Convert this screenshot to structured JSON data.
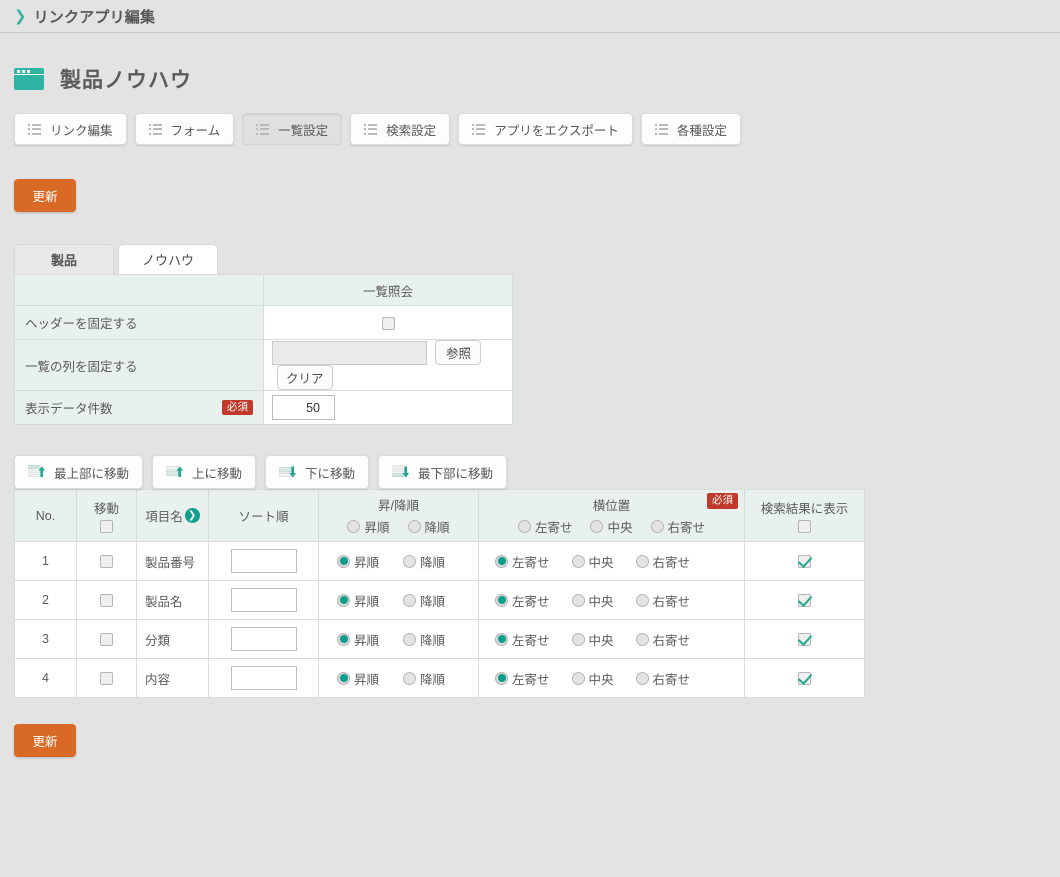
{
  "breadcrumb": {
    "icon": "chevron-right-icon",
    "label": "リンクアプリ編集"
  },
  "page": {
    "icon": "app-window-icon",
    "title": "製品ノウハウ"
  },
  "toolbar": {
    "items": [
      {
        "label": "リンク編集",
        "icon": "list-icon",
        "active": false
      },
      {
        "label": "フォーム",
        "icon": "list-icon",
        "active": false
      },
      {
        "label": "一覧設定",
        "icon": "list-icon",
        "active": true
      },
      {
        "label": "検索設定",
        "icon": "list-icon",
        "active": false
      },
      {
        "label": "アプリをエクスポート",
        "icon": "list-icon",
        "active": false
      },
      {
        "label": "各種設定",
        "icon": "list-icon",
        "active": false
      }
    ]
  },
  "update_top_label": "更新",
  "update_bottom_label": "更新",
  "tabs": [
    {
      "label": "製品",
      "selected": false
    },
    {
      "label": "ノウハウ",
      "selected": true
    }
  ],
  "settings": {
    "column_header": "一覧照会",
    "rows": [
      {
        "label": "ヘッダーを固定する",
        "type": "checkbox",
        "checked": false
      },
      {
        "label": "一覧の列を固定する",
        "type": "picker",
        "value": "",
        "browse_label": "参照",
        "clear_label": "クリア"
      },
      {
        "label": "表示データ件数",
        "required_badge": "必須",
        "type": "number",
        "value": "50"
      }
    ]
  },
  "move_buttons": [
    {
      "label": "最上部に移動",
      "icon": "move-top-icon"
    },
    {
      "label": "上に移動",
      "icon": "move-up-icon"
    },
    {
      "label": "下に移動",
      "icon": "move-down-icon"
    },
    {
      "label": "最下部に移動",
      "icon": "move-bottom-icon"
    }
  ],
  "field_table": {
    "headers": {
      "no": "No.",
      "move": "移動",
      "move_all_checked": false,
      "name": "項目名",
      "name_icon": "chevron-right-circle-icon",
      "sort": "ソート順",
      "order_title": "昇/降順",
      "order_asc": "昇順",
      "order_desc": "降順",
      "order_asc_checked": false,
      "order_desc_checked": false,
      "align_title": "横位置",
      "align_required_badge": "必須",
      "align_left": "左寄せ",
      "align_center": "中央",
      "align_right": "右寄せ",
      "align_left_checked": false,
      "align_center_checked": false,
      "align_right_checked": false,
      "show": "検索結果に表示",
      "show_all_checked": false
    },
    "rows": [
      {
        "no": "1",
        "move_checked": false,
        "name": "製品番号",
        "sort_value": "",
        "order": "asc",
        "align": "left",
        "show_checked": true
      },
      {
        "no": "2",
        "move_checked": false,
        "name": "製品名",
        "sort_value": "",
        "order": "asc",
        "align": "left",
        "show_checked": true
      },
      {
        "no": "3",
        "move_checked": false,
        "name": "分類",
        "sort_value": "",
        "order": "asc",
        "align": "left",
        "show_checked": true
      },
      {
        "no": "4",
        "move_checked": false,
        "name": "内容",
        "sort_value": "",
        "order": "asc",
        "align": "left",
        "show_checked": true
      }
    ]
  },
  "colors": {
    "accent_teal": "#2fb4a4",
    "radio_teal": "#0a9e8e",
    "update_orange": "#d96a26",
    "required_red": "#c0392b",
    "header_mint": "#e9f1ef",
    "page_bg": "#e3e3e3"
  }
}
